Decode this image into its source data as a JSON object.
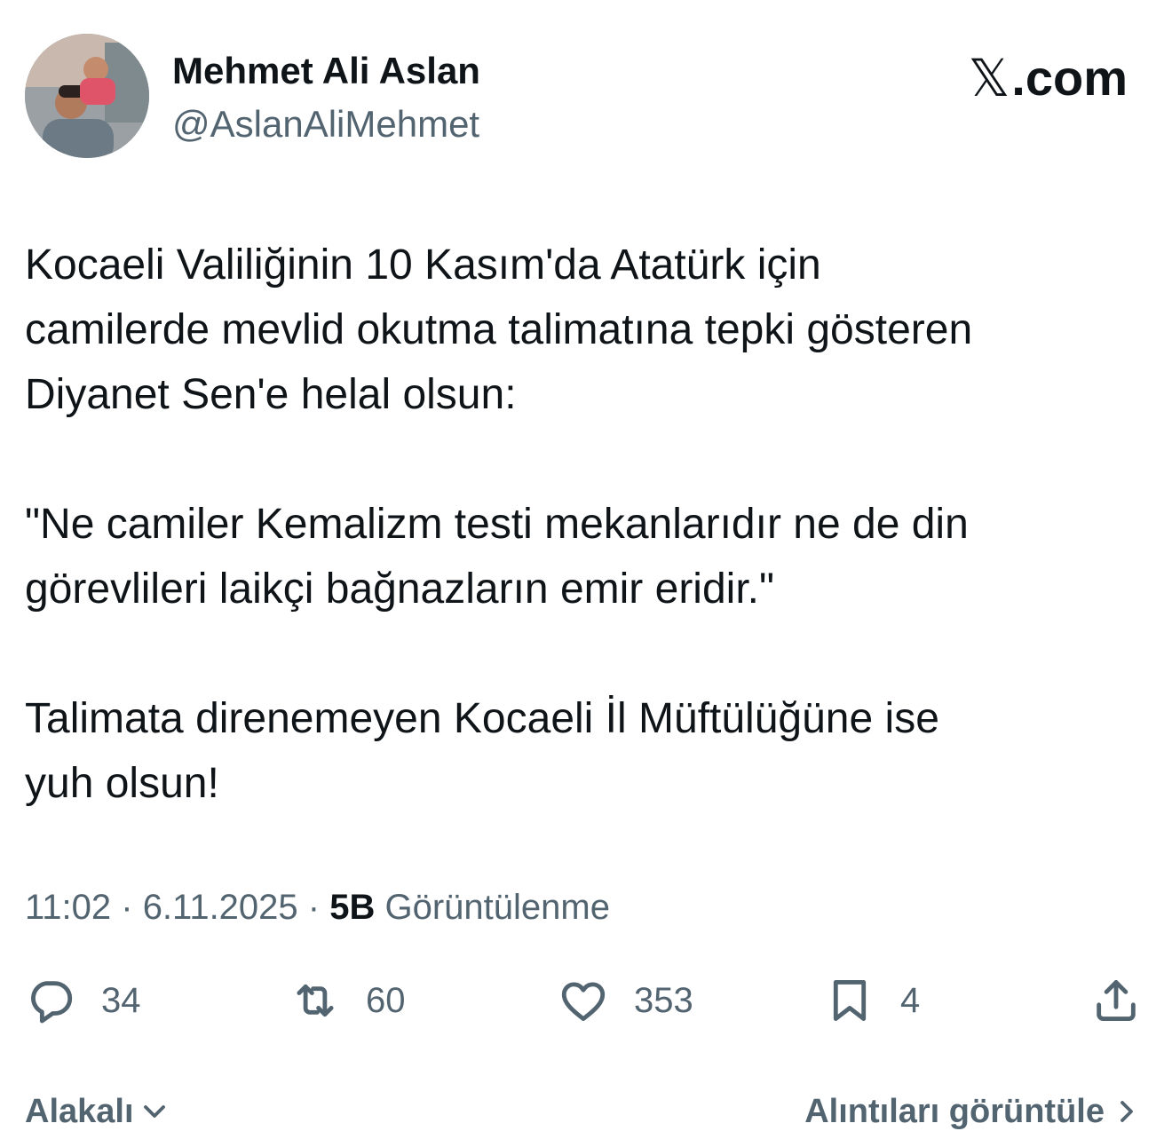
{
  "author": {
    "display_name": "Mehmet Ali Aslan",
    "handle": "@AslanAliMehmet"
  },
  "brand": {
    "x_glyph": "𝕏",
    "suffix": ".com"
  },
  "tweet": {
    "paragraphs": [
      "Kocaeli Valiliğinin 10 Kasım'da Atatürk için\ncamilerde mevlid okutma talimatına tepki gösteren\nDiyanet Sen'e helal olsun:",
      "\"Ne camiler Kemalizm testi mekanlarıdır ne de din\ngörevlileri laikçi bağnazların emir eridir.\"",
      "Talimata direnemeyen Kocaeli İl Müftülüğüne ise\nyuh olsun!"
    ]
  },
  "meta": {
    "time": "11:02",
    "separator": " · ",
    "date": "6.11.2025",
    "views_count": "5B",
    "views_label": "Görüntülenme"
  },
  "actions": {
    "replies": "34",
    "reposts": "60",
    "likes": "353",
    "bookmarks": "4"
  },
  "footer": {
    "related_label": "Alakalı",
    "quotes_label": "Alıntıları görüntüle"
  },
  "icons": {
    "reply": "reply-icon",
    "repost": "repost-icon",
    "like": "heart-icon",
    "bookmark": "bookmark-icon",
    "share": "share-icon",
    "related": "chevron-down-icon",
    "quotes": "chevron-right-icon"
  },
  "colors": {
    "text_primary": "#0f1419",
    "text_secondary": "#536471",
    "background": "#ffffff"
  }
}
